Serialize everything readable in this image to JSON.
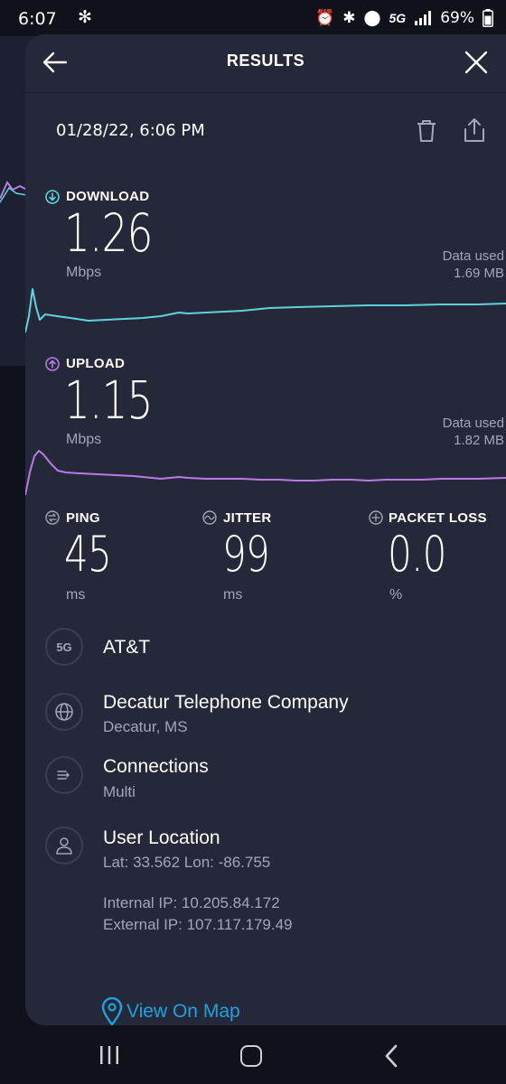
{
  "status_bar": {
    "time": "6:07",
    "network": "5G",
    "battery": "69%"
  },
  "header": {
    "title": "RESULTS"
  },
  "result": {
    "date": "01/28/22, 6:06 PM"
  },
  "download": {
    "label": "DOWNLOAD",
    "value": "1.26",
    "unit": "Mbps",
    "data_used_label": "Data used",
    "data_used_value": "1.69 MB",
    "color": "#5fd3db"
  },
  "upload": {
    "label": "UPLOAD",
    "value": "1.15",
    "unit": "Mbps",
    "data_used_label": "Data used",
    "data_used_value": "1.82 MB",
    "color": "#b97ae8"
  },
  "ping": {
    "label": "PING",
    "value": "45",
    "unit": "ms"
  },
  "jitter": {
    "label": "JITTER",
    "value": "99",
    "unit": "ms"
  },
  "packet_loss": {
    "label": "PACKET LOSS",
    "value": "0.0",
    "unit": "%"
  },
  "carrier": {
    "badge": "5G",
    "name": "AT&T"
  },
  "server": {
    "name": "Decatur Telephone Company",
    "location": "Decatur, MS"
  },
  "connections": {
    "title": "Connections",
    "value": "Multi"
  },
  "user_location": {
    "title": "User Location",
    "coords": "Lat: 33.562 Lon: -86.755",
    "internal_ip": "Internal IP: 10.205.84.172",
    "external_ip": "External IP: 107.117.179.49"
  },
  "map_link": {
    "label": "View On Map",
    "color": "#1aa3e2"
  }
}
